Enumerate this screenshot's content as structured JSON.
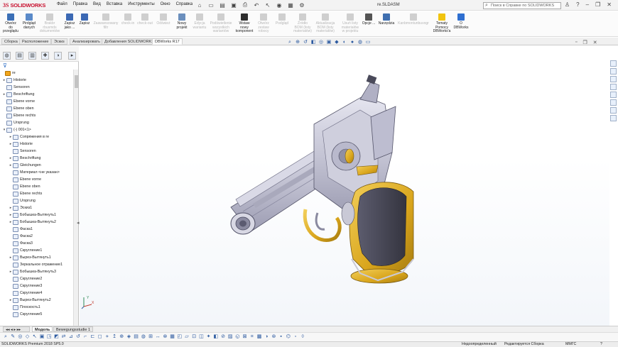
{
  "app": {
    "brand_ds": "3S",
    "brand_name": "SOLIDWORKS",
    "document_title": "re.SLDASM",
    "help_search_placeholder": "Поиск в Справке по SOLIDWORKS"
  },
  "menu": [
    "Файл",
    "Правка",
    "Вид",
    "Вставка",
    "Инструменты",
    "Окно",
    "Справка"
  ],
  "ribbon": [
    {
      "label": "Otwórz\ndo\nprzeglądu",
      "enabled": true,
      "icon": "open-icon",
      "color": "#3b6fb6"
    },
    {
      "label": "Pirdgląd\ndanych",
      "enabled": true,
      "icon": "preview-icon",
      "color": "#5a8ac9"
    },
    {
      "label": "Brakbr\nrbusmds\ndokumentów",
      "enabled": false,
      "icon": "missing-docs-icon",
      "color": "#cfcfcf"
    },
    {
      "label": "Zapisz\njako ...",
      "enabled": true,
      "icon": "save-as-icon",
      "color": "#3c69b4"
    },
    {
      "label": "Zapisz",
      "enabled": true,
      "icon": "save-icon",
      "color": "#3c69b4"
    },
    {
      "label": "Zaawansowany\nfiltr",
      "enabled": false,
      "icon": "filter-icon",
      "color": "#cfcfcf"
    },
    {
      "label": "check-in",
      "enabled": false,
      "icon": "check-in-icon",
      "color": "#cfcfcf"
    },
    {
      "label": "check-out",
      "enabled": false,
      "icon": "check-out-icon",
      "color": "#cfcfcf"
    },
    {
      "label": "Odśwież",
      "enabled": false,
      "icon": "refresh-icon",
      "color": "#cfcfcf"
    },
    {
      "label": "Nowy\nprojekt",
      "enabled": true,
      "icon": "new-project-icon",
      "color": "#6b8fbd"
    },
    {
      "label": "Edycja\nwariantu",
      "enabled": false,
      "icon": "edit-variant-icon",
      "color": "#cfcfcf"
    },
    {
      "label": "Podświetlenie\nwszystkich\nwariantów",
      "enabled": false,
      "icon": "highlight-variants-icon",
      "color": "#cfcfcf"
    },
    {
      "label": "Wstaw\nnowy\nkomponent",
      "enabled": true,
      "icon": "insert-component-icon",
      "color": "#2e2e2e"
    },
    {
      "label": "Otwórz\nzestaw\nrobocy",
      "enabled": false,
      "icon": "open-workset-icon",
      "color": "#cfcfcf"
    },
    {
      "label": "Podgląd",
      "enabled": false,
      "icon": "preview2-icon",
      "color": "#cfcfcf"
    },
    {
      "label": "Źródło\nBOM (listy\nmateriałów)",
      "enabled": false,
      "icon": "bom-source-icon",
      "color": "#cfcfcf"
    },
    {
      "label": "Aktualizacja\nBOM (listy\nmateriałów)",
      "enabled": false,
      "icon": "bom-update-icon",
      "color": "#cfcfcf"
    },
    {
      "label": "Usuń listy\nmateriałów\nw projektu",
      "enabled": false,
      "icon": "bom-delete-icon",
      "color": "#cfcfcf"
    },
    {
      "label": "Opcje ...",
      "enabled": true,
      "icon": "options-icon",
      "color": "#555555"
    },
    {
      "label": "Narzędzia",
      "enabled": true,
      "icon": "tools-icon",
      "color": "#3f6fb0"
    },
    {
      "label": "Kanbmontunbuvogr",
      "enabled": false,
      "icon": "kanban-icon",
      "color": "#cfcfcf"
    },
    {
      "label": "Tematy\nPomocy\nDBWorks'a",
      "enabled": true,
      "icon": "help-topics-icon",
      "color": "#f1c40f"
    },
    {
      "label": "O\nDBWorks",
      "enabled": true,
      "icon": "about-icon",
      "color": "#2f6fd0"
    }
  ],
  "tabs": [
    "Сборка",
    "Расположение",
    "Эскиз",
    "Анализировать",
    "Добавления SOLIDWORKS",
    "DBWorks R17"
  ],
  "active_tab": "DBWorks R17",
  "tree": [
    {
      "label": "re",
      "depth": 0,
      "arrow": "",
      "root": true
    },
    {
      "label": "Historie",
      "depth": 1,
      "arrow": "▸"
    },
    {
      "label": "Sensoren",
      "depth": 1,
      "arrow": ""
    },
    {
      "label": "Beschriftung",
      "depth": 1,
      "arrow": "▸"
    },
    {
      "label": "Ebene vorne",
      "depth": 1,
      "arrow": ""
    },
    {
      "label": "Ebene oben",
      "depth": 1,
      "arrow": ""
    },
    {
      "label": "Ebene rechts",
      "depth": 1,
      "arrow": ""
    },
    {
      "label": "Ursprung",
      "depth": 1,
      "arrow": ""
    },
    {
      "label": "(-) 001<1>",
      "depth": 1,
      "arrow": "▾"
    },
    {
      "label": "Сопряжения в re",
      "depth": 2,
      "arrow": "▸"
    },
    {
      "label": "Historie",
      "depth": 2,
      "arrow": "▸"
    },
    {
      "label": "Sensoren",
      "depth": 2,
      "arrow": ""
    },
    {
      "label": "Beschriftung",
      "depth": 2,
      "arrow": "▸"
    },
    {
      "label": "Gleichungen",
      "depth": 2,
      "arrow": "▸"
    },
    {
      "label": "Материал <не указан>",
      "depth": 2,
      "arrow": ""
    },
    {
      "label": "Ebene vorne",
      "depth": 2,
      "arrow": ""
    },
    {
      "label": "Ebene oben",
      "depth": 2,
      "arrow": ""
    },
    {
      "label": "Ebene rechts",
      "depth": 2,
      "arrow": ""
    },
    {
      "label": "Ursprung",
      "depth": 2,
      "arrow": ""
    },
    {
      "label": "Эскиз1",
      "depth": 2,
      "arrow": "▸"
    },
    {
      "label": "Бобышка-Вытянуть1",
      "depth": 2,
      "arrow": "▸"
    },
    {
      "label": "Бобышка-Вытянуть2",
      "depth": 2,
      "arrow": "▸"
    },
    {
      "label": "Фаска1",
      "depth": 2,
      "arrow": ""
    },
    {
      "label": "Фаска2",
      "depth": 2,
      "arrow": ""
    },
    {
      "label": "Фаска3",
      "depth": 2,
      "arrow": ""
    },
    {
      "label": "Скругление1",
      "depth": 2,
      "arrow": ""
    },
    {
      "label": "Вырез-Вытянуть1",
      "depth": 2,
      "arrow": "▸"
    },
    {
      "label": "Зеркальное отражение1",
      "depth": 2,
      "arrow": ""
    },
    {
      "label": "Бобышка-Вытянуть3",
      "depth": 2,
      "arrow": "▸"
    },
    {
      "label": "Скругление2",
      "depth": 2,
      "arrow": ""
    },
    {
      "label": "Скругление3",
      "depth": 2,
      "arrow": ""
    },
    {
      "label": "Скругление4",
      "depth": 2,
      "arrow": ""
    },
    {
      "label": "Вырез-Вытянуть2",
      "depth": 2,
      "arrow": "▸"
    },
    {
      "label": "Плоскость1",
      "depth": 2,
      "arrow": ""
    },
    {
      "label": "Скругление5",
      "depth": 2,
      "arrow": ""
    }
  ],
  "bottom_tabs": [
    "Модель",
    "Bewegungsstudie 1"
  ],
  "active_bottom_tab": "Модель",
  "status": {
    "product": "SOLIDWORKS Premium 2018 SP5.0",
    "state": "Недоопределенный",
    "mode": "Редактируется Сборка",
    "units": "MMГС"
  },
  "triad": {
    "axis_x": "X",
    "axis_y": "Y"
  },
  "colors": {
    "accent": "#c8102e",
    "brass": "#d9a51c",
    "steel": "#c9c9d6",
    "grip": "#4a4a5a"
  }
}
